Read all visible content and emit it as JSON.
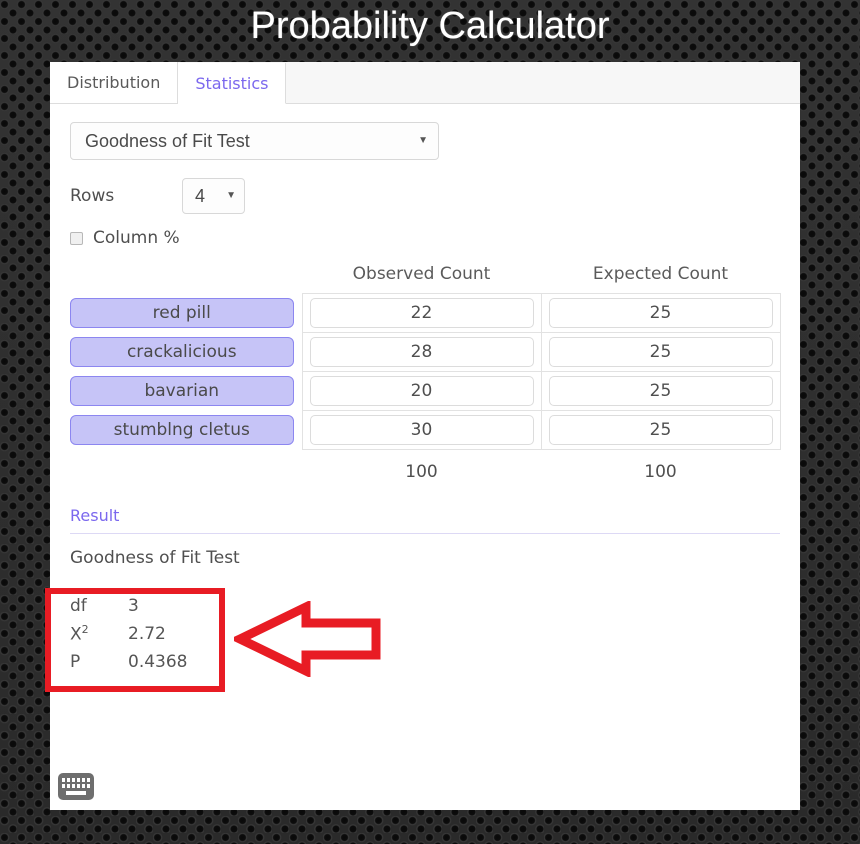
{
  "page": {
    "title": "Probability Calculator"
  },
  "tabs": [
    {
      "label": "Distribution",
      "active": false
    },
    {
      "label": "Statistics",
      "active": true
    }
  ],
  "controls": {
    "test_select": {
      "value": "Goodness of Fit Test",
      "caret_icon": "chevron-down-icon"
    },
    "rows": {
      "label": "Rows",
      "value": "4",
      "caret_icon": "chevron-down-icon"
    },
    "column_pct": {
      "label": "Column %",
      "checked": false
    }
  },
  "table": {
    "headers": {
      "label_col": "",
      "observed": "Observed Count",
      "expected": "Expected Count"
    },
    "rows": [
      {
        "label": "red pill",
        "observed": "22",
        "expected": "25"
      },
      {
        "label": "crackalicious",
        "observed": "28",
        "expected": "25"
      },
      {
        "label": "bavarian",
        "observed": "20",
        "expected": "25"
      },
      {
        "label": "stumblng cletus",
        "observed": "30",
        "expected": "25"
      }
    ],
    "totals": {
      "observed": "100",
      "expected": "100"
    }
  },
  "result": {
    "heading": "Result",
    "subtitle": "Goodness of Fit Test",
    "stats": [
      {
        "key": "df",
        "sup": "",
        "value": "3"
      },
      {
        "key": "X",
        "sup": "2",
        "value": "2.72"
      },
      {
        "key": "P",
        "sup": "",
        "value": "0.4368"
      }
    ]
  },
  "footer": {
    "keyboard_icon": "keyboard-icon"
  },
  "annotations": {
    "highlight_color": "#e81c24",
    "box_target": "result-stats-box",
    "arrow_direction": "left"
  },
  "theme": {
    "accent": "#7b68ee",
    "pill_fill": "#c6c4f7",
    "pill_border": "#8c86f0",
    "background": "#2e2e2e"
  }
}
